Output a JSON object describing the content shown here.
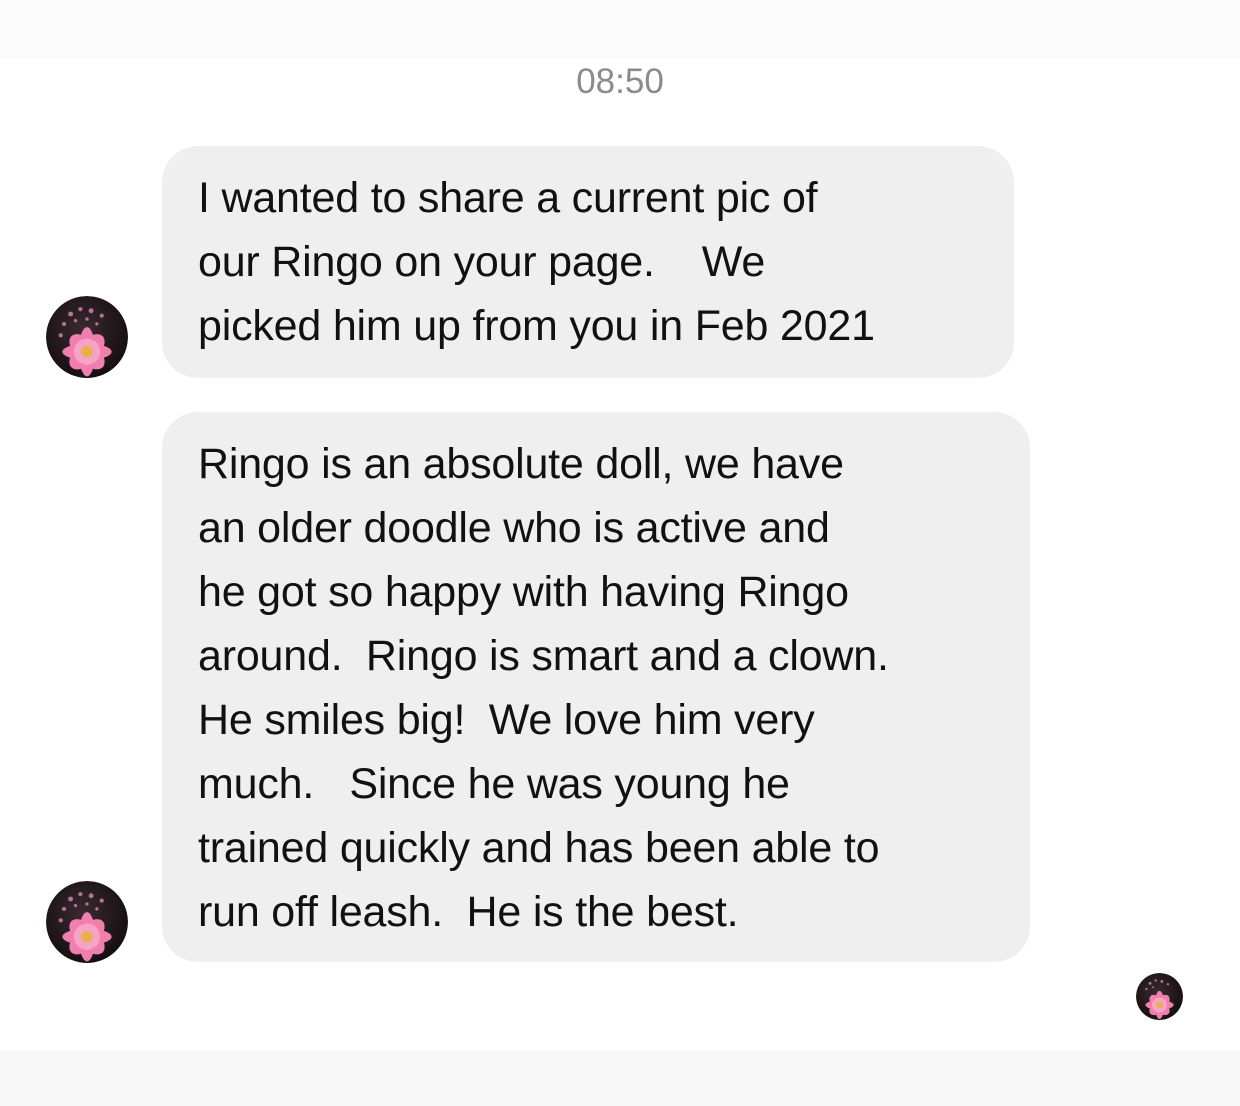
{
  "timestamp": "08:50",
  "messages": [
    {
      "lines": [
        "I wanted to share a current pic of",
        "our Ringo on your page.    We",
        "picked him up from you in Feb 2021"
      ]
    },
    {
      "lines": [
        "Ringo is an absolute doll, we have",
        "an older doodle who is active and",
        "he got so happy with having Ringo",
        "around.  Ringo is smart and a clown.",
        "He smiles big!  We love him very",
        "much.   Since he was young he",
        "trained quickly and has been able to",
        "run off leash.  He is the best."
      ]
    }
  ],
  "avatar_icon": "pink-flower-avatar-icon",
  "colors": {
    "bubble_bg": "#efeff0",
    "text": "#111111",
    "timestamp": "#8b8b8b",
    "flower_pink": "#f07fae"
  }
}
